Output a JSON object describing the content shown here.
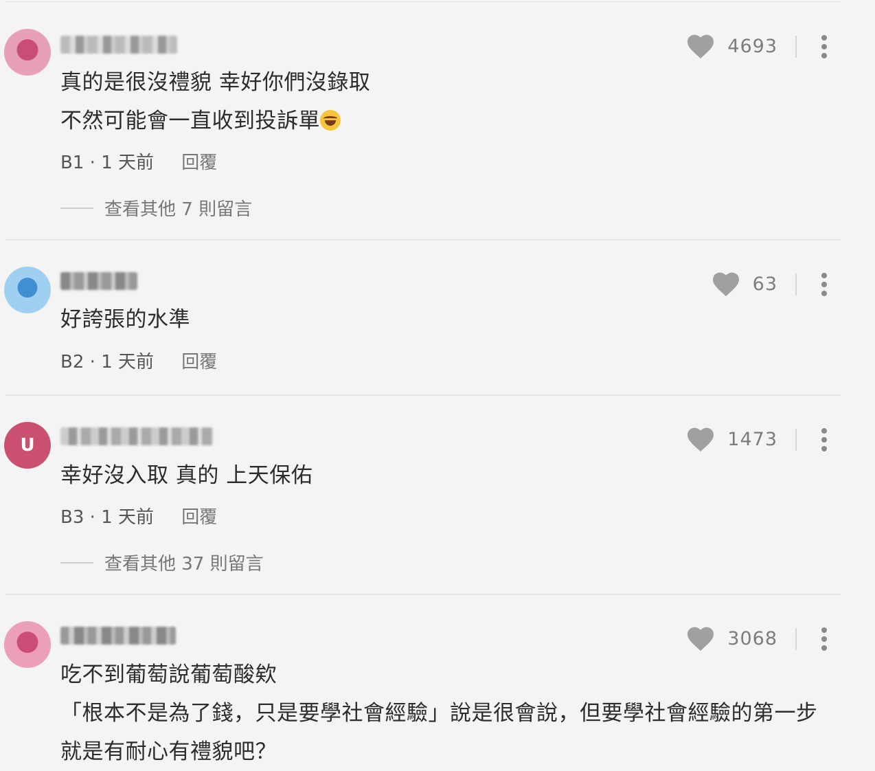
{
  "comments": [
    {
      "avatar_glyph": "",
      "avatar_color": "#e596b0",
      "content_lines": [
        "真的是很沒禮貌 幸好你們沒錄取",
        "不然可能會一直收到投訴單"
      ],
      "emoji_icon": "face-with-tears-of-joy-icon",
      "floor": "B1",
      "time": "1 天前",
      "reply_label": "回覆",
      "likes": "4693",
      "more_replies": "查看其他 7 則留言"
    },
    {
      "avatar_glyph": "",
      "avatar_color": "#8cc8ef",
      "content_lines": [
        "好誇張的水準"
      ],
      "floor": "B2",
      "time": "1 天前",
      "reply_label": "回覆",
      "likes": "63"
    },
    {
      "avatar_glyph": "U",
      "avatar_color": "#c9506f",
      "content_lines": [
        "幸好沒入取 真的 上天保佑"
      ],
      "floor": "B3",
      "time": "1 天前",
      "reply_label": "回覆",
      "likes": "1473",
      "more_replies": "查看其他 37 則留言"
    },
    {
      "avatar_glyph": "",
      "avatar_color": "#e38aa6",
      "content_lines": [
        "吃不到葡萄說葡萄酸欸",
        "「根本不是為了錢，只是要學社會經驗」說是很會說，但要學社會經驗的第一步",
        "就是有耐心有禮貌吧？"
      ],
      "likes": "3068"
    }
  ],
  "colors": {
    "background": "#f4f4f4",
    "heart": "#a0a0a0",
    "divider": "#e4e4e4"
  }
}
